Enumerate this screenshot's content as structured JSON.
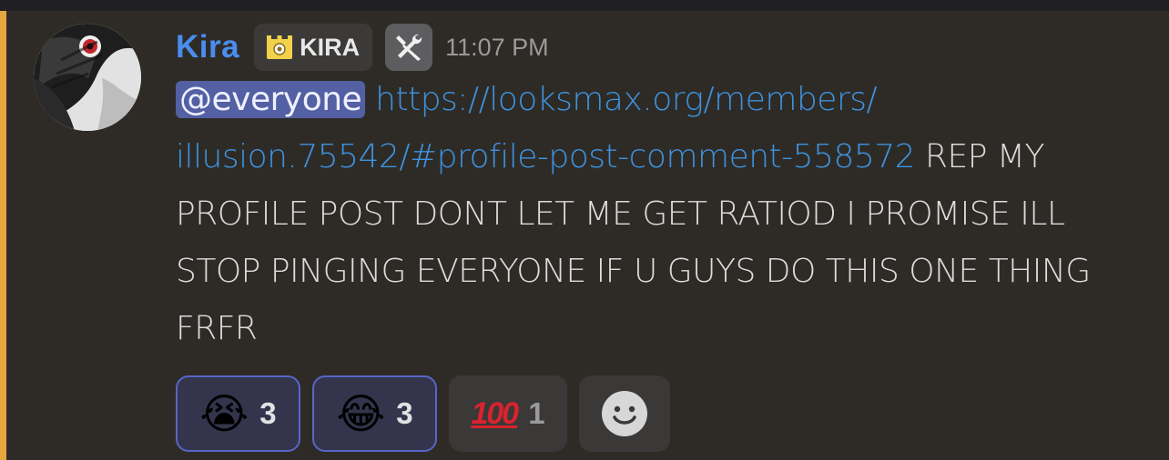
{
  "message": {
    "author": "Kira",
    "role_tag": "KIRA",
    "role_icon": "crown-castle-icon",
    "badge_icon": "hammer-wrench-icon",
    "timestamp": "11:07 PM",
    "mention": "@everyone",
    "link": "https://looksmax.org/members/illusion.75542/#profile-post-comment-558572",
    "link_line1": "https://looksmax.org/members/",
    "link_line2": "illusion.75542/#profile-post-comment-558572",
    "text": " REP MY PROFILE POST DONT LET ME GET RATIOD I PROMISE ILL STOP PINGING EVERYONE IF U GUYS DO THIS ONE THING FRFR"
  },
  "reactions": [
    {
      "emoji": "😭",
      "name": "loudly-crying-face",
      "count": "3",
      "active": true
    },
    {
      "emoji": "😂",
      "name": "face-with-tears-of-joy",
      "count": "3",
      "active": true
    },
    {
      "emoji": "100",
      "name": "hundred-points",
      "count": "1",
      "active": false
    }
  ],
  "add_reaction_icon": "add-reaction-smiley-icon",
  "colors": {
    "background": "#2e2b27",
    "highlight": "#e6a73e",
    "username": "#4a8df0",
    "link": "#3d93df",
    "mention_bg": "#5360a3"
  }
}
